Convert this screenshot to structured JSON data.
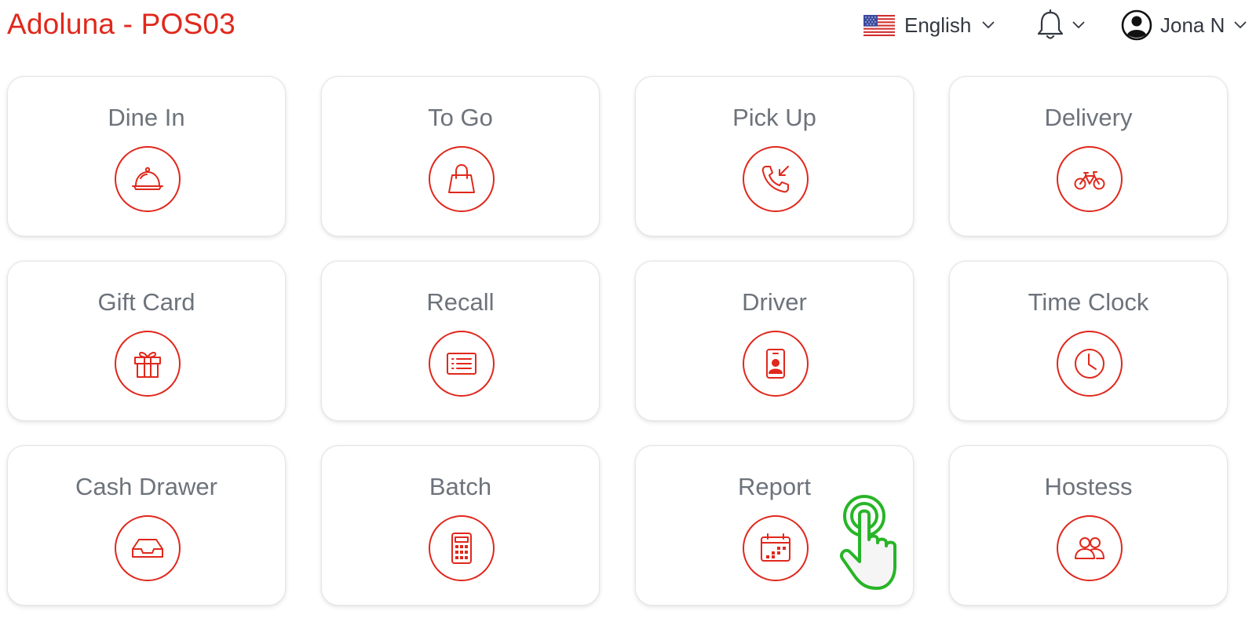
{
  "header": {
    "title": "Adoluna - POS03",
    "language": {
      "label": "English",
      "flag_icon": "us-flag-icon"
    },
    "notifications": {
      "icon": "bell-icon"
    },
    "user": {
      "name": "Jona N",
      "icon": "user-circle-icon"
    }
  },
  "accent_color": "#e0281c",
  "tiles": [
    {
      "label": "Dine In",
      "icon": "cloche-icon"
    },
    {
      "label": "To Go",
      "icon": "shopping-bag-icon"
    },
    {
      "label": "Pick Up",
      "icon": "incoming-call-icon"
    },
    {
      "label": "Delivery",
      "icon": "bicycle-icon"
    },
    {
      "label": "Gift Card",
      "icon": "gift-icon"
    },
    {
      "label": "Recall",
      "icon": "list-icon"
    },
    {
      "label": "Driver",
      "icon": "id-badge-icon"
    },
    {
      "label": "Time Clock",
      "icon": "clock-icon"
    },
    {
      "label": "Cash Drawer",
      "icon": "tray-icon"
    },
    {
      "label": "Batch",
      "icon": "calculator-icon"
    },
    {
      "label": "Report",
      "icon": "calendar-icon"
    },
    {
      "label": "Hostess",
      "icon": "people-icon"
    }
  ],
  "overlay": {
    "icon": "tap-hand-icon"
  }
}
